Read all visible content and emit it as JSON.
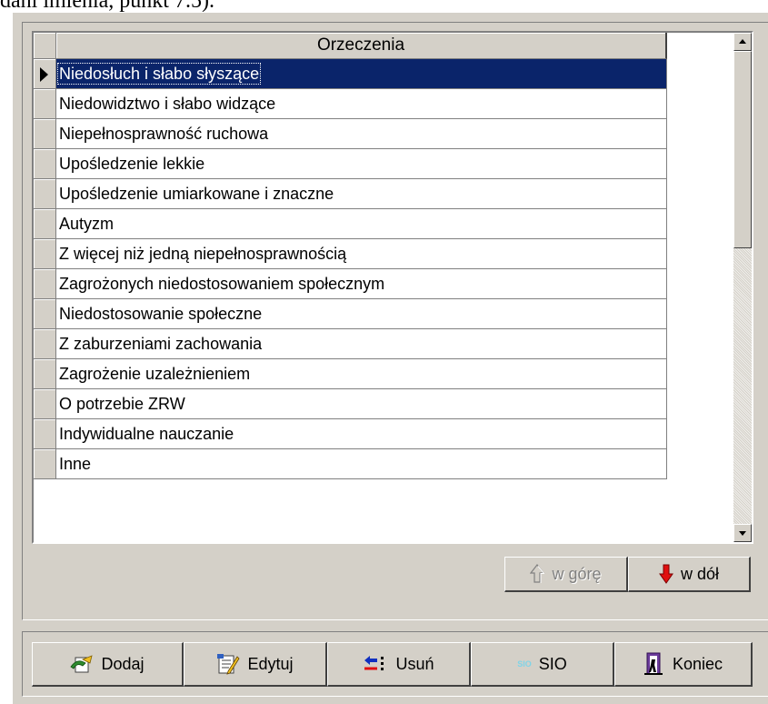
{
  "doc_caption": "dani imienia, punkt 7.5).",
  "grid": {
    "column_header": "Orzeczenia",
    "selected_index": 0,
    "rows": [
      "Niedosłuch i słabo słyszące",
      "Niedowidztwo i słabo widzące",
      "Niepełnosprawność ruchowa",
      "Upośledzenie lekkie",
      "Upośledzenie umiarkowane i znaczne",
      "Autyzm",
      "Z więcej niż jedną niepełnosprawnością",
      "Zagrożonych niedostosowaniem społecznym",
      "Niedostosowanie społeczne",
      "Z zaburzeniami zachowania",
      "Zagrożenie uzależnieniem",
      "O potrzebie ZRW",
      "Indywidualne nauczanie",
      "Inne"
    ]
  },
  "move_buttons": {
    "up_label": "w górę",
    "down_label": "w dół",
    "up_icon": "arrow-up-outline-icon",
    "down_icon": "arrow-down-red-icon"
  },
  "toolbar": {
    "add_label": "Dodaj",
    "edit_label": "Edytuj",
    "delete_label": "Usuń",
    "sio_label": "SIO",
    "sio_icon_text": "SIO",
    "exit_label": "Koniec"
  },
  "colors": {
    "face": "#d4d0c8",
    "selection": "#0a246a",
    "arrow_red": "#e01010",
    "sio_icon": "#7fd4e8"
  }
}
